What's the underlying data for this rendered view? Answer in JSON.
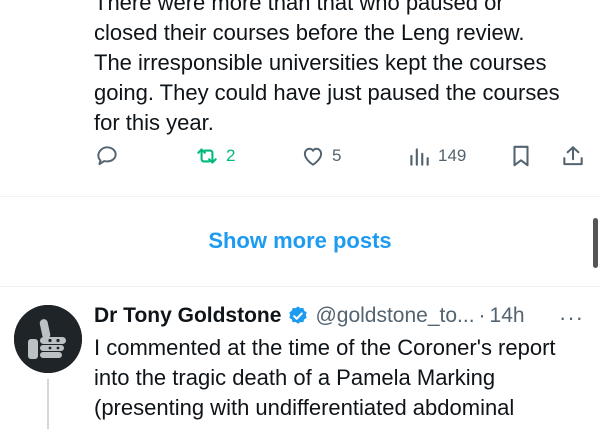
{
  "post1": {
    "text_lines": [
      "There were more than that who paused or",
      "closed their courses before the Leng review.",
      "The irresponsible universities kept the courses",
      "going.  They could have just paused the courses",
      "for this year."
    ],
    "actions": {
      "reply_icon": "reply-icon",
      "retweet_icon": "retweet-icon",
      "retweet_count": "2",
      "like_icon": "heart-icon",
      "like_count": "5",
      "views_icon": "views-icon",
      "views_count": "149",
      "bookmark_icon": "bookmark-icon",
      "share_icon": "share-icon"
    }
  },
  "show_more": {
    "label": "Show more posts"
  },
  "post2": {
    "author_name": "Dr Tony Goldstone",
    "verified_icon": "verified-badge-icon",
    "handle": "@goldstone_to...",
    "separator": "·",
    "time": "14h",
    "more_icon": "more-icon",
    "more_label": "···",
    "text_lines": [
      "I commented at the time of the Coroner's report",
      "into the tragic death of a Pamela Marking",
      "(presenting with undifferentiated abdominal"
    ]
  },
  "colors": {
    "accent": "#1d9bf0",
    "retweet_green": "#00ba7c",
    "secondary_text": "#536471",
    "primary_text": "#0f1419"
  }
}
